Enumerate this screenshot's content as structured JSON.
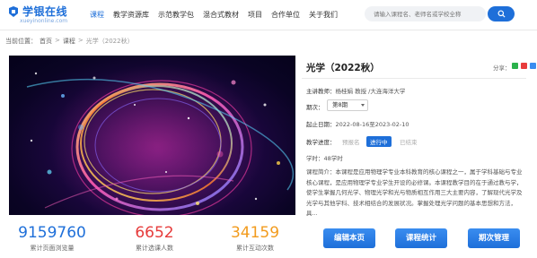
{
  "header": {
    "logo_title": "学银在线",
    "logo_subtitle": "xueyinonline.com",
    "nav": [
      {
        "label": "课程",
        "active": true
      },
      {
        "label": "教学资源库",
        "active": false
      },
      {
        "label": "示范教学包",
        "active": false
      },
      {
        "label": "混合式教材",
        "active": false
      },
      {
        "label": "项目",
        "active": false
      },
      {
        "label": "合作单位",
        "active": false
      },
      {
        "label": "关于我们",
        "active": false
      }
    ],
    "search_placeholder": "请输入课程名、老师名或学校全称",
    "search_icon": "search-icon"
  },
  "breadcrumb": {
    "prefix": "当前位置：",
    "items": [
      "首页",
      "课程",
      "光学（2022秋）"
    ],
    "separator": ">"
  },
  "course": {
    "title": "光学（2022秋）",
    "share_label": "分享：",
    "teacher_label": "主讲教师：",
    "teacher": "杨桂娟 教授 /大连海洋大学",
    "term_label": "期次：",
    "term_value": "第8期",
    "dates_label": "起止日期：",
    "dates": "2022-08-16至2023-02-10",
    "progress_label": "教学进度：",
    "progress_states": [
      {
        "label": "预报名",
        "active": false
      },
      {
        "label": "进行中",
        "active": true
      },
      {
        "label": "已结束",
        "active": false
      }
    ],
    "hours": "学时：48学时",
    "intro_label": "课程简介：",
    "intro": "本课程是应用物理学专业本科教育的核心课程之一，属于学科基础与专业核心课程，是应用物理学专业学生开设的必修课。本课程教学目的在于通过教与学，使学生掌握几何光学、物理光学和光与物质相互作用三大主要内容，了解现代光学及光学与其他学科、技术相结合的发展状况。掌握处理光学问题的基本思想和方法，具..."
  },
  "stats": [
    {
      "value": "9159760",
      "label": "累计页面浏览量",
      "color": "#1e6fd9"
    },
    {
      "value": "6652",
      "label": "累计选课人数",
      "color": "#e63b3b"
    },
    {
      "value": "34159",
      "label": "累计互动次数",
      "color": "#f29b1d"
    }
  ],
  "actions": [
    "编辑本页",
    "课程统计",
    "期次管理"
  ],
  "colors": {
    "brand": "#1e6fd9",
    "share_icons": [
      "#2bb24c",
      "#e83c3c",
      "#3a8df0"
    ]
  }
}
